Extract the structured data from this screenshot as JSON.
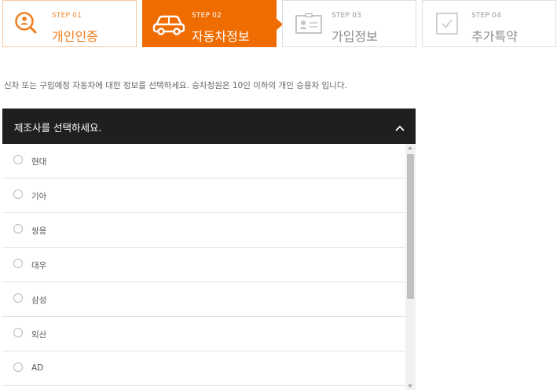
{
  "steps": [
    {
      "num": "STEP 01",
      "title": "개인인증",
      "state": "done",
      "icon": "search-person-icon"
    },
    {
      "num": "STEP 02",
      "title": "자동차정보",
      "state": "active",
      "icon": "car-icon"
    },
    {
      "num": "STEP 03",
      "title": "가입정보",
      "state": "inactive",
      "icon": "id-card-icon"
    },
    {
      "num": "STEP 04",
      "title": "추가특약",
      "state": "inactive",
      "icon": "checkbox-icon"
    }
  ],
  "intro": "신차 또는 구입예정 자동차에 대한 정보를 선택하세요. 승차정원은 10인 이하의 개인 승용차 입니다.",
  "manufacturer_panel": {
    "title": "제조사를 선택하세요.",
    "options": [
      "현대",
      "기아",
      "쌍용",
      "대우",
      "삼성",
      "외산",
      "AD"
    ]
  },
  "colors": {
    "accent": "#ef6c00",
    "header_bg": "#1f1f1f"
  }
}
